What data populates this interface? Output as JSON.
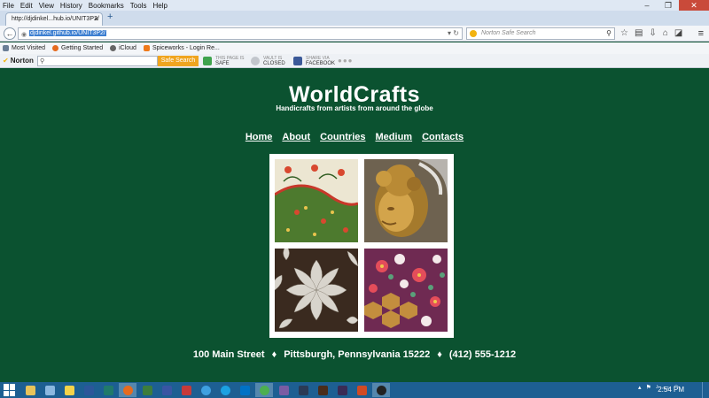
{
  "menu": [
    "File",
    "Edit",
    "View",
    "History",
    "Bookmarks",
    "Tools",
    "Help"
  ],
  "tab": {
    "title": "http://djdinkel...hub.io/UNIT3P2/"
  },
  "urlbar": {
    "url": "djdinkel.github.io/UNIT3P2/"
  },
  "search": {
    "placeholder": "Norton Safe Search"
  },
  "bookmarks": [
    "Most Visited",
    "Getting Started",
    "iCloud",
    "Spiceworks - Login Re..."
  ],
  "norton": {
    "logo": "Norton",
    "search_button": "Safe Search",
    "page_status_label": "THIS PAGE IS",
    "page_status_value": "SAFE",
    "vault_label": "VAULT IS",
    "vault_value": "CLOSED",
    "share_label": "SHARE VIA",
    "share_value": "FACEBOOK"
  },
  "site": {
    "title": "WorldCrafts",
    "subtitle": "Handicrafts from artists from around the globe",
    "nav": [
      "Home",
      "About",
      "Countries",
      "Medium",
      "Contacts"
    ],
    "footer": {
      "street": "100 Main Street",
      "city": "Pittsburgh, Pennsylvania 15222",
      "phone": "(412) 555-1212",
      "separator": "♦"
    }
  },
  "taskbar": {
    "clock": "2:54 PM"
  },
  "colors": {
    "page_bg": "#0b5230",
    "taskbar": "#1d5f92",
    "norton_button": "#f0a520"
  }
}
